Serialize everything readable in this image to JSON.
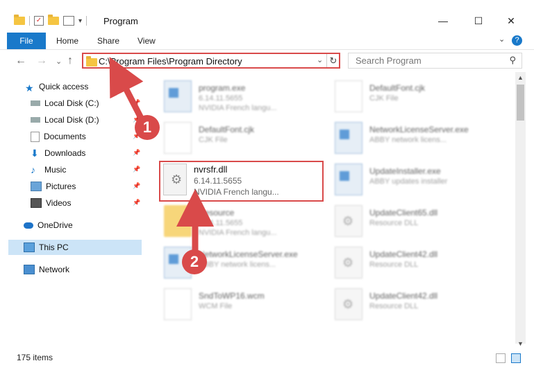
{
  "window": {
    "title": "Program",
    "minimize_glyph": "—",
    "maximize_glyph": "☐",
    "close_glyph": "✕"
  },
  "ribbon": {
    "tabs": [
      "File",
      "Home",
      "Share",
      "View"
    ],
    "help_glyph": "?",
    "expand_glyph": "⌄"
  },
  "nav": {
    "back_glyph": "←",
    "forward_glyph": "→",
    "recent_glyph": "⌄",
    "up_glyph": "↑",
    "address_path": "C:\\Program Files\\Program Directory",
    "address_dropdown_glyph": "⌄",
    "refresh_glyph": "↻",
    "search_placeholder": "Search Program",
    "search_glyph": "⚲"
  },
  "sidebar": {
    "items": [
      {
        "label": "Quick access",
        "icon": "star-icon"
      },
      {
        "label": "Local Disk (C:)",
        "icon": "drive-icon"
      },
      {
        "label": "Local Disk (D:)",
        "icon": "drive-icon"
      },
      {
        "label": "Documents",
        "icon": "documents-icon"
      },
      {
        "label": "Downloads",
        "icon": "downloads-icon"
      },
      {
        "label": "Music",
        "icon": "music-icon"
      },
      {
        "label": "Pictures",
        "icon": "pictures-icon"
      },
      {
        "label": "Videos",
        "icon": "videos-icon"
      },
      {
        "label": "OneDrive",
        "icon": "cloud-icon"
      },
      {
        "label": "This PC",
        "icon": "computer-icon"
      },
      {
        "label": "Network",
        "icon": "network-icon"
      }
    ],
    "pin_glyph": "📌"
  },
  "files": {
    "left": [
      {
        "name": "program.exe",
        "line1": "6.14.11.5655",
        "line2": "NVIDIA French langu..."
      },
      {
        "name": "DefaultFont.cjk",
        "line1": "CJK File",
        "line2": ""
      },
      {
        "name": "nvrsfr.dll",
        "line1": "6.14.11.5655",
        "line2": "NVIDIA French langu..."
      },
      {
        "name": "Resource",
        "line1": "6.14.11.5655",
        "line2": "NVIDIA French langu..."
      },
      {
        "name": "NetworkLicenseServer.exe",
        "line1": "ABBY network licens...",
        "line2": ""
      },
      {
        "name": "SndToWP16.wcm",
        "line1": "WCM File",
        "line2": ""
      }
    ],
    "right": [
      {
        "name": "DefaultFont.cjk",
        "line1": "CJK File",
        "line2": ""
      },
      {
        "name": "NetworkLicenseServer.exe",
        "line1": "ABBY network licens...",
        "line2": ""
      },
      {
        "name": "UpdateInstaller.exe",
        "line1": "ABBY updates installer",
        "line2": ""
      },
      {
        "name": "UpdateClient65.dll",
        "line1": "Resource DLL",
        "line2": ""
      },
      {
        "name": "UpdateClient42.dll",
        "line1": "Resource DLL",
        "line2": ""
      },
      {
        "name": "UpdateClient42.dll",
        "line1": "Resource DLL",
        "line2": ""
      }
    ]
  },
  "annotations": {
    "marker1": "1",
    "marker2": "2",
    "accent_color": "#d94a4a"
  },
  "status": {
    "item_count": "175 items"
  }
}
